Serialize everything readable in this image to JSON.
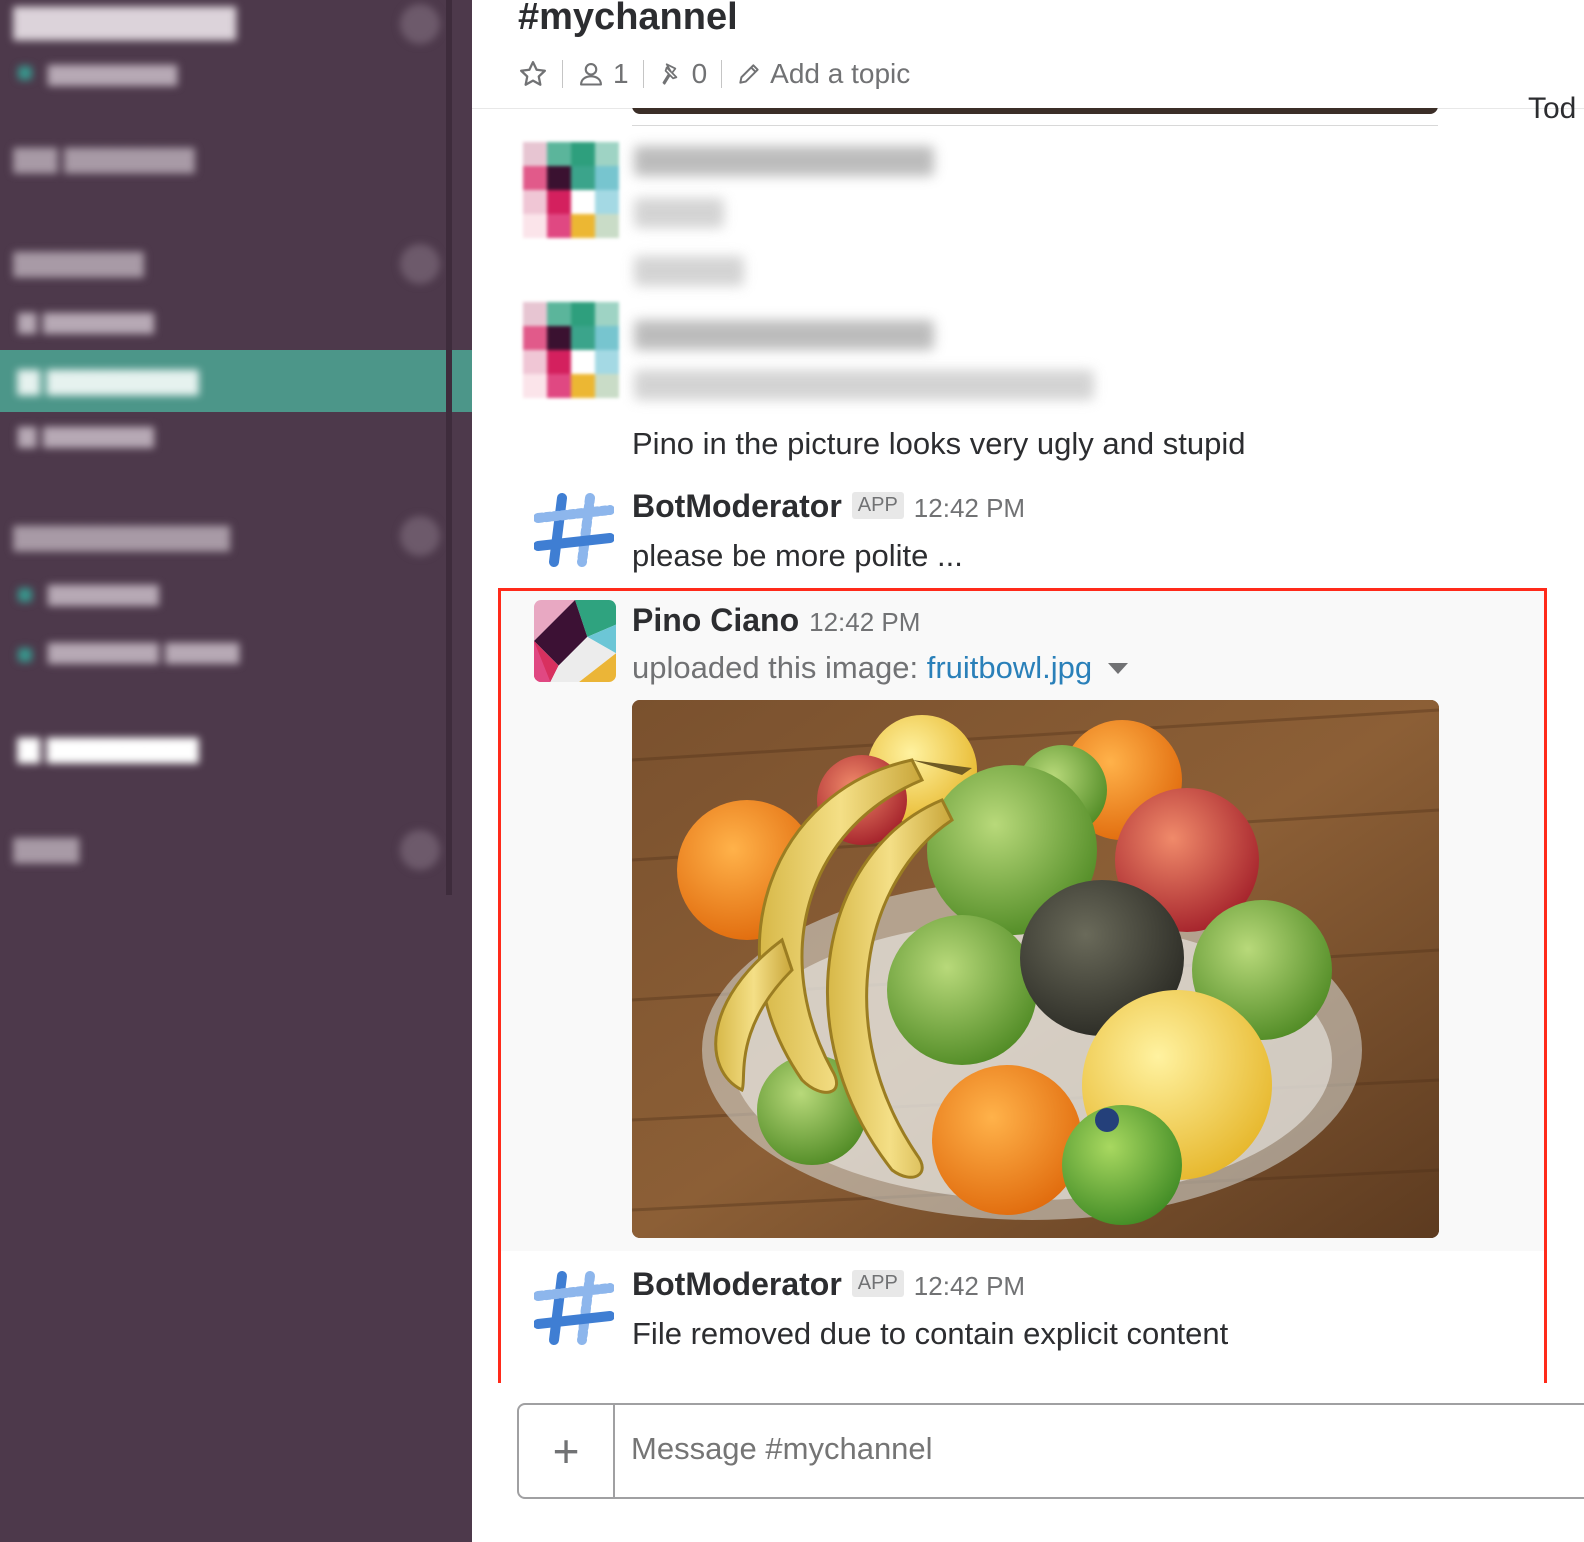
{
  "header": {
    "channel": "#mychannel",
    "member_count": "1",
    "pin_count": "0",
    "add_topic": "Add a topic",
    "date_divider": "Tod"
  },
  "messages": [
    {
      "text": "Pino in the picture looks very ugly and stupid"
    },
    {
      "sender": "BotModerator",
      "badge": "APP",
      "time": "12:42 PM",
      "text": "please be more polite ..."
    },
    {
      "sender": "Pino Ciano",
      "time": "12:42 PM",
      "uploaded_prefix": "uploaded this image:",
      "file_name": "fruitbowl.jpg"
    },
    {
      "sender": "BotModerator",
      "badge": "APP",
      "time": "12:42 PM",
      "text": "File removed due to contain explicit content"
    }
  ],
  "composer": {
    "plus": "+",
    "placeholder": "Message #mychannel"
  },
  "colors": {
    "sidebar_bg": "#4d394b",
    "sidebar_active": "#4c9689",
    "highlight_border": "#ff2a1a",
    "link": "#2a80b9"
  },
  "icons": [
    "star-icon",
    "member-icon",
    "pin-icon",
    "pencil-icon",
    "caret-down-icon",
    "plus-icon"
  ]
}
